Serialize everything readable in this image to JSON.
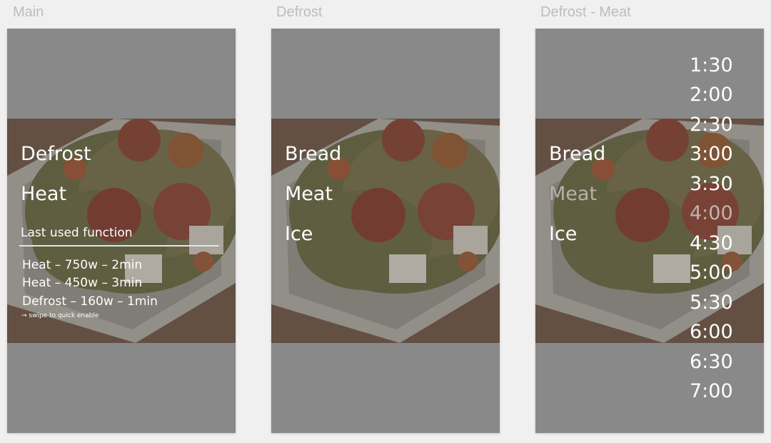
{
  "artboards": {
    "main": {
      "label": "Main"
    },
    "defrost": {
      "label": "Defrost"
    },
    "defrost_meat": {
      "label": "Defrost - Meat"
    }
  },
  "main_screen": {
    "menu": [
      "Defrost",
      "Heat"
    ],
    "last_used_title": "Last used function",
    "recent": [
      "Heat – 750w – 2min",
      "Heat – 450w – 3min",
      "Defrost – 160w – 1min"
    ],
    "hint": "→ swipe to quick enable"
  },
  "defrost_screen": {
    "menu": [
      "Bread",
      "Meat",
      "Ice"
    ]
  },
  "defrost_meat_screen": {
    "menu": [
      "Bread",
      "Meat",
      "Ice"
    ],
    "selected_item": "Meat",
    "times": [
      "1:30",
      "2:00",
      "2:30",
      "3:00",
      "3:30",
      "4:00",
      "4:30",
      "5:00",
      "5:30",
      "6:00",
      "6:30",
      "7:00"
    ],
    "selected_time": "4:00"
  },
  "colors": {
    "page_background": "#f0f0f0",
    "screen_background": "#898989",
    "text_primary": "#ffffff",
    "text_dimmed": "#b9b0ab",
    "artboard_label": "#bdbdbd"
  },
  "background_image": {
    "icon": "food-photo",
    "description_visible": false
  }
}
